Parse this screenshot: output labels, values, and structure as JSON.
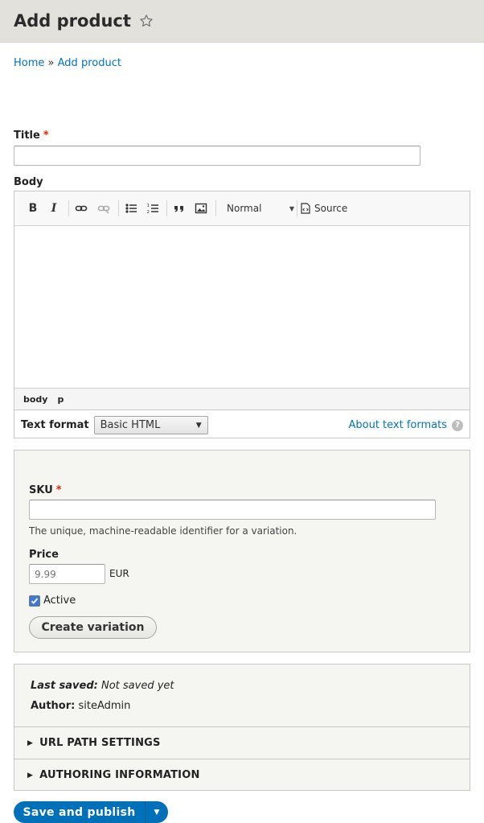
{
  "header": {
    "title": "Add product"
  },
  "breadcrumb": {
    "home": "Home",
    "separator": "»",
    "current": "Add product"
  },
  "title_field": {
    "label": "Title",
    "required_marker": "*",
    "value": ""
  },
  "body_field": {
    "label": "Body",
    "toolbar": {
      "bold": "B",
      "italic": "I",
      "format_value": "Normal",
      "source_label": "Source"
    },
    "path": [
      "body",
      "p"
    ],
    "text_format_label": "Text format",
    "text_format_value": "Basic HTML",
    "about_link": "About text formats",
    "help_glyph": "?"
  },
  "variation": {
    "sku_label": "SKU",
    "required_marker": "*",
    "sku_value": "",
    "sku_description": "The unique, machine-readable identifier for a variation.",
    "price_label": "Price",
    "price_placeholder": "9.99",
    "currency": "EUR",
    "active_label": "Active",
    "active_checked": true,
    "create_button": "Create variation"
  },
  "meta": {
    "last_saved_label": "Last saved:",
    "last_saved_value": "Not saved yet",
    "author_label": "Author:",
    "author_value": "siteAdmin",
    "url_path_settings": "URL PATH SETTINGS",
    "authoring_information": "AUTHORING INFORMATION"
  },
  "actions": {
    "save_publish": "Save and publish"
  },
  "colors": {
    "accent": "#0071b8",
    "link": "#0074bd",
    "required": "#e62600",
    "header_bg": "#e2e1dc"
  }
}
